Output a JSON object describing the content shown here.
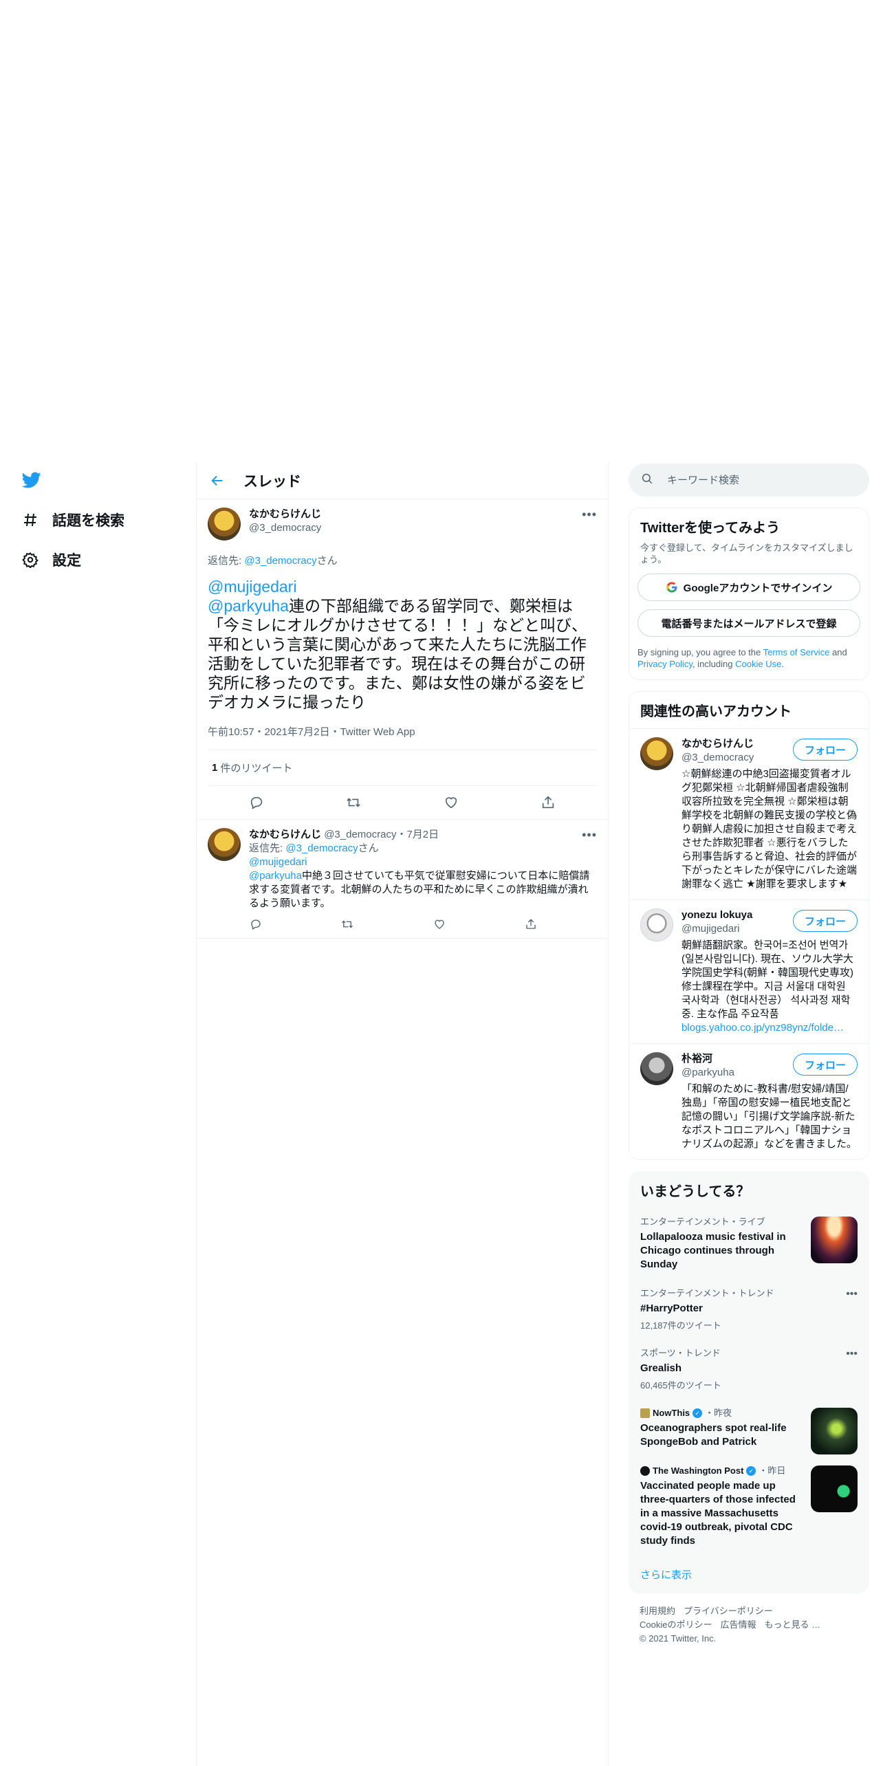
{
  "nav": {
    "explore_label": "話題を検索",
    "settings_label": "設定"
  },
  "thread": {
    "header_title": "スレッド",
    "main_tweet": {
      "author_name": "なかむらけんじ",
      "author_handle": "@3_democracy",
      "reply_prefix": "返信先: ",
      "reply_to_handle": "@3_democracy",
      "reply_suffix": "さん",
      "mention1": "@mujigedari",
      "mention2": "@parkyuha",
      "text": "連の下部組織である留学同で、鄭栄桓は「今ミレにオルグかけさせてる！！！」などと叫び、平和という言葉に関心があって来た人たちに洗脳工作活動をしていた犯罪者です。現在はその舞台がこの研究所に移ったのです。また、鄭は女性の嫌がる姿をビデオカメラに撮ったり",
      "meta": "午前10:57・2021年7月2日・Twitter Web App",
      "retweet_number": "1",
      "retweet_label": "件のリツイート"
    },
    "reply_tweet": {
      "author_name": "なかむらけんじ",
      "author_handle": "@3_democracy",
      "date": "・7月2日",
      "reply_prefix": "返信先: ",
      "reply_to_handle": "@3_democracy",
      "reply_suffix": "さん",
      "mention1": "@mujigedari",
      "mention2": "@parkyuha",
      "text": "中絶３回させていても平気で従軍慰安婦について日本に賠償請求する変質者です。北朝鮮の人たちの平和ために早くこの詐欺組織が潰れるよう願います。"
    }
  },
  "search": {
    "placeholder": "キーワード検索"
  },
  "signup": {
    "title": "Twitterを使ってみよう",
    "subtitle": "今すぐ登録して、タイムラインをカスタマイズしましょう。",
    "google_button": "Googleアカウントでサインイン",
    "phone_button": "電話番号またはメールアドレスで登録",
    "legal_prefix": "By signing up, you agree to the ",
    "terms": "Terms of Service",
    "legal_and": " and ",
    "privacy": "Privacy Policy",
    "legal_including": ", including ",
    "cookie": "Cookie Use",
    "legal_end": "."
  },
  "relevant": {
    "title": "関連性の高いアカウント",
    "follow_label": "フォロー",
    "accounts": [
      {
        "name": "なかむらけんじ",
        "handle": "@3_democracy",
        "bio": "☆朝鮮総連の中絶3回盗撮変質者オルグ犯鄭栄桓 ☆北朝鮮帰国者虐殺強制収容所拉致を完全無視 ☆鄭栄桓は朝鮮学校を北朝鮮の難民支援の学校と偽り朝鮮人虐殺に加担させ自殺まで考えさせた詐欺犯罪者 ☆悪行をバラしたら刑事告訴すると脅迫、社会的評価が下がったとキレたが保守にバレた途端謝罪なく逃亡 ★謝罪を要求します★",
        "link": ""
      },
      {
        "name": "yonezu lokuya",
        "handle": "@mujigedari",
        "bio": "朝鮮語翻訳家。한국어=조선어 번역가(일본사람입니다). 現在、ソウル大学大学院国史学科(朝鮮・韓国現代史専攻)修士課程在学中。지금 서울대 대학원 국사학과（현대사전공） 석사과정 재학중. 主な作品 주요작품",
        "link": "blogs.yahoo.co.jp/ynz98ynz/folde…"
      },
      {
        "name": "朴裕河",
        "handle": "@parkyuha",
        "bio": "「和解のために-教科書/慰安婦/靖国/独島」「帝国の慰安婦ー植民地支配と記憶の闘い」「引揚げ文学論序説-新たなポストコロニアルへ」「韓国ナショナリズムの起源」などを書きました。",
        "link": ""
      }
    ]
  },
  "trends": {
    "title": "いまどうしてる？",
    "items": [
      {
        "category": "エンターテインメント・ライブ",
        "title": "Lollapalooza music festival in Chicago continues through Sunday"
      },
      {
        "category": "エンターテインメント・トレンド",
        "title": "#HarryPotter",
        "count": "12,187件のツイート"
      },
      {
        "category": "スポーツ・トレンド",
        "title": "Grealish",
        "count": "60,465件のツイート"
      },
      {
        "source": "NowThis",
        "time": "・昨夜",
        "title": "Oceanographers spot real-life SpongeBob and Patrick"
      },
      {
        "source": "The Washington Post",
        "time": "・昨日",
        "title": "Vaccinated people made up three-quarters of those infected in a massive Massachusetts covid-19 outbreak, pivotal CDC study finds"
      }
    ],
    "show_more": "さらに表示"
  },
  "footer": {
    "terms": "利用規約",
    "privacy": "プライバシーポリシー",
    "cookie": "Cookieのポリシー",
    "ads": "広告情報",
    "more": "もっと見る …",
    "copyright": "© 2021 Twitter, Inc."
  },
  "colors": {
    "accent": "#1d9bf0",
    "text": "#0f1419",
    "muted": "#536471",
    "border": "#eff3f4"
  }
}
